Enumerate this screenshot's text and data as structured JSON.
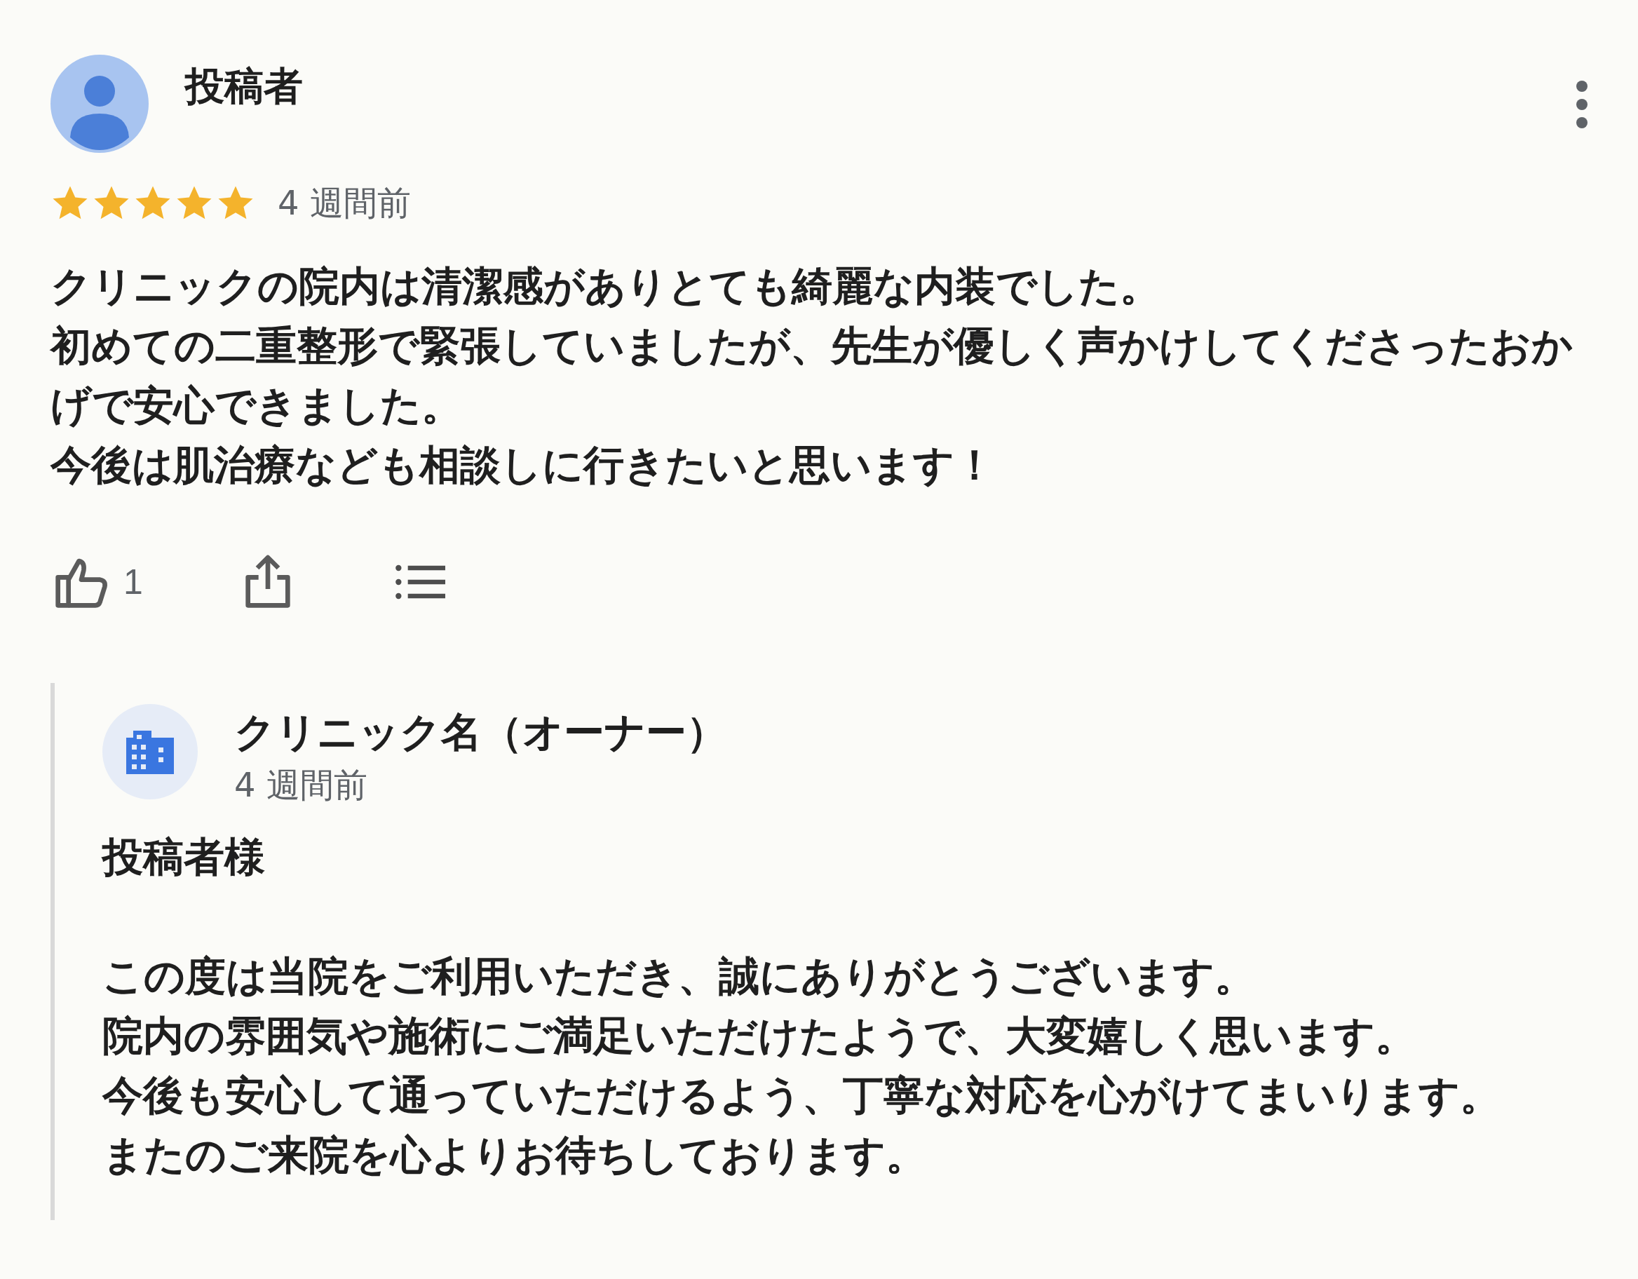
{
  "reviewer": {
    "name": "投稿者"
  },
  "review": {
    "stars": 5,
    "time": "4 週間前",
    "lines": [
      "クリニックの院内は清潔感がありとても綺麗な内装でした。",
      "初めての二重整形で緊張していましたが、先生が優しく声かけしてくださったおかげで安心できました。",
      "今後は肌治療なども相談しに行きたいと思います！"
    ]
  },
  "actions": {
    "like_count": "1"
  },
  "owner_reply": {
    "name": "クリニック名（オーナー）",
    "time": "4 週間前",
    "greeting": "投稿者様",
    "lines": [
      "この度は当院をご利用いただき、誠にありがとうございます。",
      "院内の雰囲気や施術にご満足いただけたようで、大変嬉しく思います。",
      "今後も安心して通っていただけるよう、丁寧な対応を心がけてまいります。",
      "またのご来院を心よりお待ちしております。"
    ]
  }
}
